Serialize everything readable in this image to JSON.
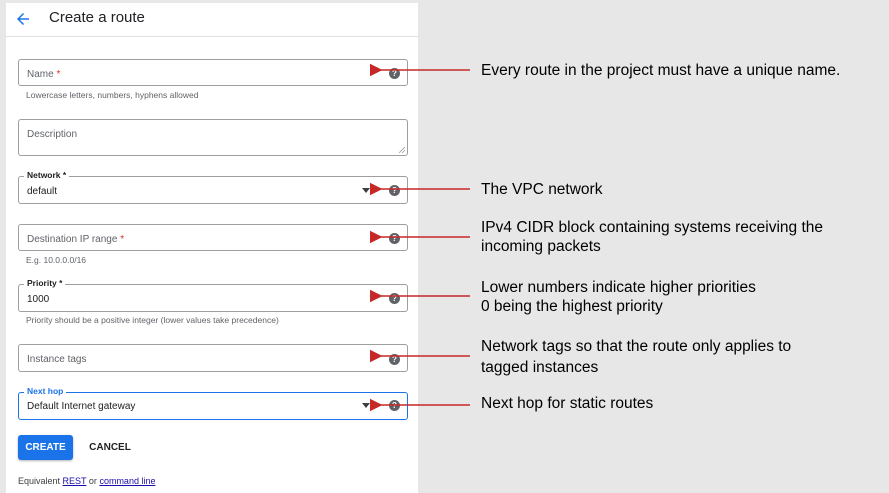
{
  "header": {
    "title": "Create a route"
  },
  "form": {
    "name": {
      "placeholder": "Name",
      "required": "*",
      "hint": "Lowercase letters, numbers, hyphens allowed"
    },
    "description": {
      "placeholder": "Description"
    },
    "network": {
      "label": "Network",
      "required": "*",
      "value": "default"
    },
    "destination": {
      "placeholder": "Destination IP range",
      "required": "*",
      "hint": "E.g. 10.0.0.0/16"
    },
    "priority": {
      "label": "Priority",
      "required": "*",
      "value": "1000",
      "hint": "Priority should be a positive integer (lower values take precedence)"
    },
    "instance_tags": {
      "placeholder": "Instance tags"
    },
    "next_hop": {
      "label": "Next hop",
      "value": "Default Internet gateway"
    }
  },
  "help_glyph": "?",
  "actions": {
    "create": "CREATE",
    "cancel": "CANCEL"
  },
  "footer": {
    "prefix": "Equivalent",
    "rest": "REST",
    "or": "or",
    "command_line": "command line"
  },
  "annotations": {
    "name": "Every route in the project must have a unique name.",
    "network": "The VPC network",
    "destination_line1": "IPv4 CIDR block containing systems receiving the",
    "destination_line2": "incoming packets",
    "priority_line1": "Lower numbers indicate higher priorities",
    "priority_line2": "0 being the highest priority",
    "tags_line1": "Network tags so that the route only applies to",
    "tags_line2": "tagged instances",
    "next_hop": "Next hop for static routes"
  },
  "colors": {
    "accent": "#1a73e8",
    "required": "#d93025",
    "arrow": "#c62828",
    "background": "#e7e7e7"
  },
  "icons": {
    "back": "arrow-left-icon",
    "help": "help-circle-icon",
    "dropdown": "caret-down-icon"
  }
}
